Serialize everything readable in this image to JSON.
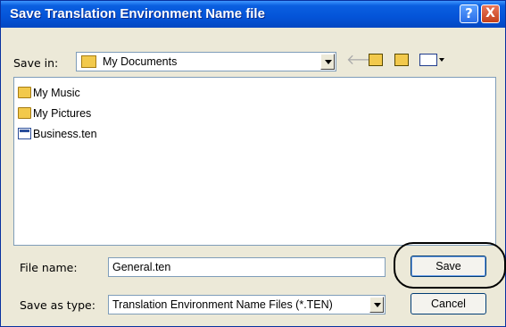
{
  "window": {
    "title": "Save Translation Environment Name file",
    "help_glyph": "?",
    "close_glyph": "X"
  },
  "save_in": {
    "label": "Save in:",
    "folder_icon": "documents-folder-icon",
    "value": "My Documents",
    "toolbar_icons": [
      "back-arrow-icon",
      "up-one-level-icon",
      "new-folder-icon",
      "views-menu-icon"
    ]
  },
  "files": [
    {
      "name": "My Music",
      "icon": "folder-icon"
    },
    {
      "name": "My Pictures",
      "icon": "folder-icon"
    },
    {
      "name": "Business.ten",
      "icon": "document-icon"
    }
  ],
  "file_name": {
    "label": "File name:",
    "value": "General.ten"
  },
  "save_as_type": {
    "label": "Save as type:",
    "value": "Translation Environment Name Files (*.TEN)"
  },
  "buttons": {
    "save": "Save",
    "cancel": "Cancel"
  },
  "colors": {
    "titlebar": "#0454d8",
    "dialog_bg": "#ece9d8",
    "highlight_ring": "#000000"
  }
}
